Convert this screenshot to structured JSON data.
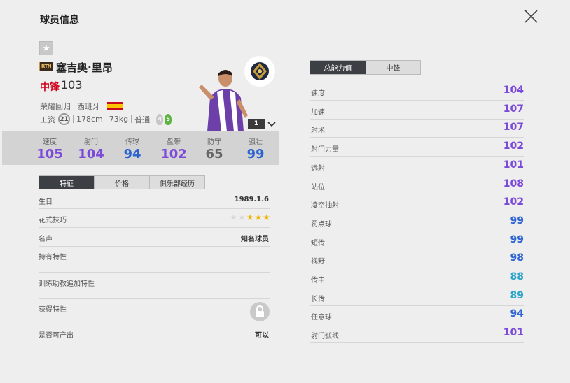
{
  "header": {
    "title": "球员信息"
  },
  "player": {
    "season_badge": "RTN",
    "name": "塞吉奥·里昂",
    "position": "中锋",
    "overall": "103",
    "season": "荣耀回归",
    "nationality": "西班牙",
    "salary": "21",
    "height": "178cm",
    "weight": "73kg",
    "body_type": "普通",
    "weak_foot": "4",
    "strong_foot": "5",
    "level": "1"
  },
  "summary_stats": [
    {
      "label": "速度",
      "value": "105",
      "color": "#7b4ad8"
    },
    {
      "label": "射门",
      "value": "104",
      "color": "#7b4ad8"
    },
    {
      "label": "传球",
      "value": "94",
      "color": "#2c63d1"
    },
    {
      "label": "盘带",
      "value": "102",
      "color": "#7b4ad8"
    },
    {
      "label": "防守",
      "value": "65",
      "color": "#666666"
    },
    {
      "label": "强壮",
      "value": "99",
      "color": "#2c63d1"
    }
  ],
  "left_tabs": [
    "特征",
    "价格",
    "俱乐部经历"
  ],
  "info": {
    "birth_label": "生日",
    "birth_value": "1989.1.6",
    "skill_label": "花式技巧",
    "skill_stars": 3,
    "skill_max": 5,
    "fame_label": "名声",
    "fame_value": "知名球员",
    "traits_label": "持有特性",
    "coach_traits_label": "训练助教追加特性",
    "acquired_traits_label": "获得特性",
    "tradable_label": "是否可产出",
    "tradable_value": "可以"
  },
  "right_tabs": [
    "总能力值",
    "中锋"
  ],
  "attributes": [
    {
      "label": "速度",
      "value": "104",
      "color": "#7b4ad8"
    },
    {
      "label": "加速",
      "value": "107",
      "color": "#7b4ad8"
    },
    {
      "label": "射术",
      "value": "107",
      "color": "#7b4ad8"
    },
    {
      "label": "射门力量",
      "value": "102",
      "color": "#7b4ad8"
    },
    {
      "label": "远射",
      "value": "101",
      "color": "#7b4ad8"
    },
    {
      "label": "站位",
      "value": "108",
      "color": "#7b4ad8"
    },
    {
      "label": "凌空抽射",
      "value": "102",
      "color": "#7b4ad8"
    },
    {
      "label": "罚点球",
      "value": "99",
      "color": "#2c63d1"
    },
    {
      "label": "短传",
      "value": "99",
      "color": "#2c63d1"
    },
    {
      "label": "视野",
      "value": "98",
      "color": "#2c63d1"
    },
    {
      "label": "传中",
      "value": "88",
      "color": "#2aa3c9"
    },
    {
      "label": "长传",
      "value": "89",
      "color": "#2aa3c9"
    },
    {
      "label": "任意球",
      "value": "94",
      "color": "#2c63d1"
    },
    {
      "label": "射门弧线",
      "value": "101",
      "color": "#7b4ad8"
    }
  ]
}
